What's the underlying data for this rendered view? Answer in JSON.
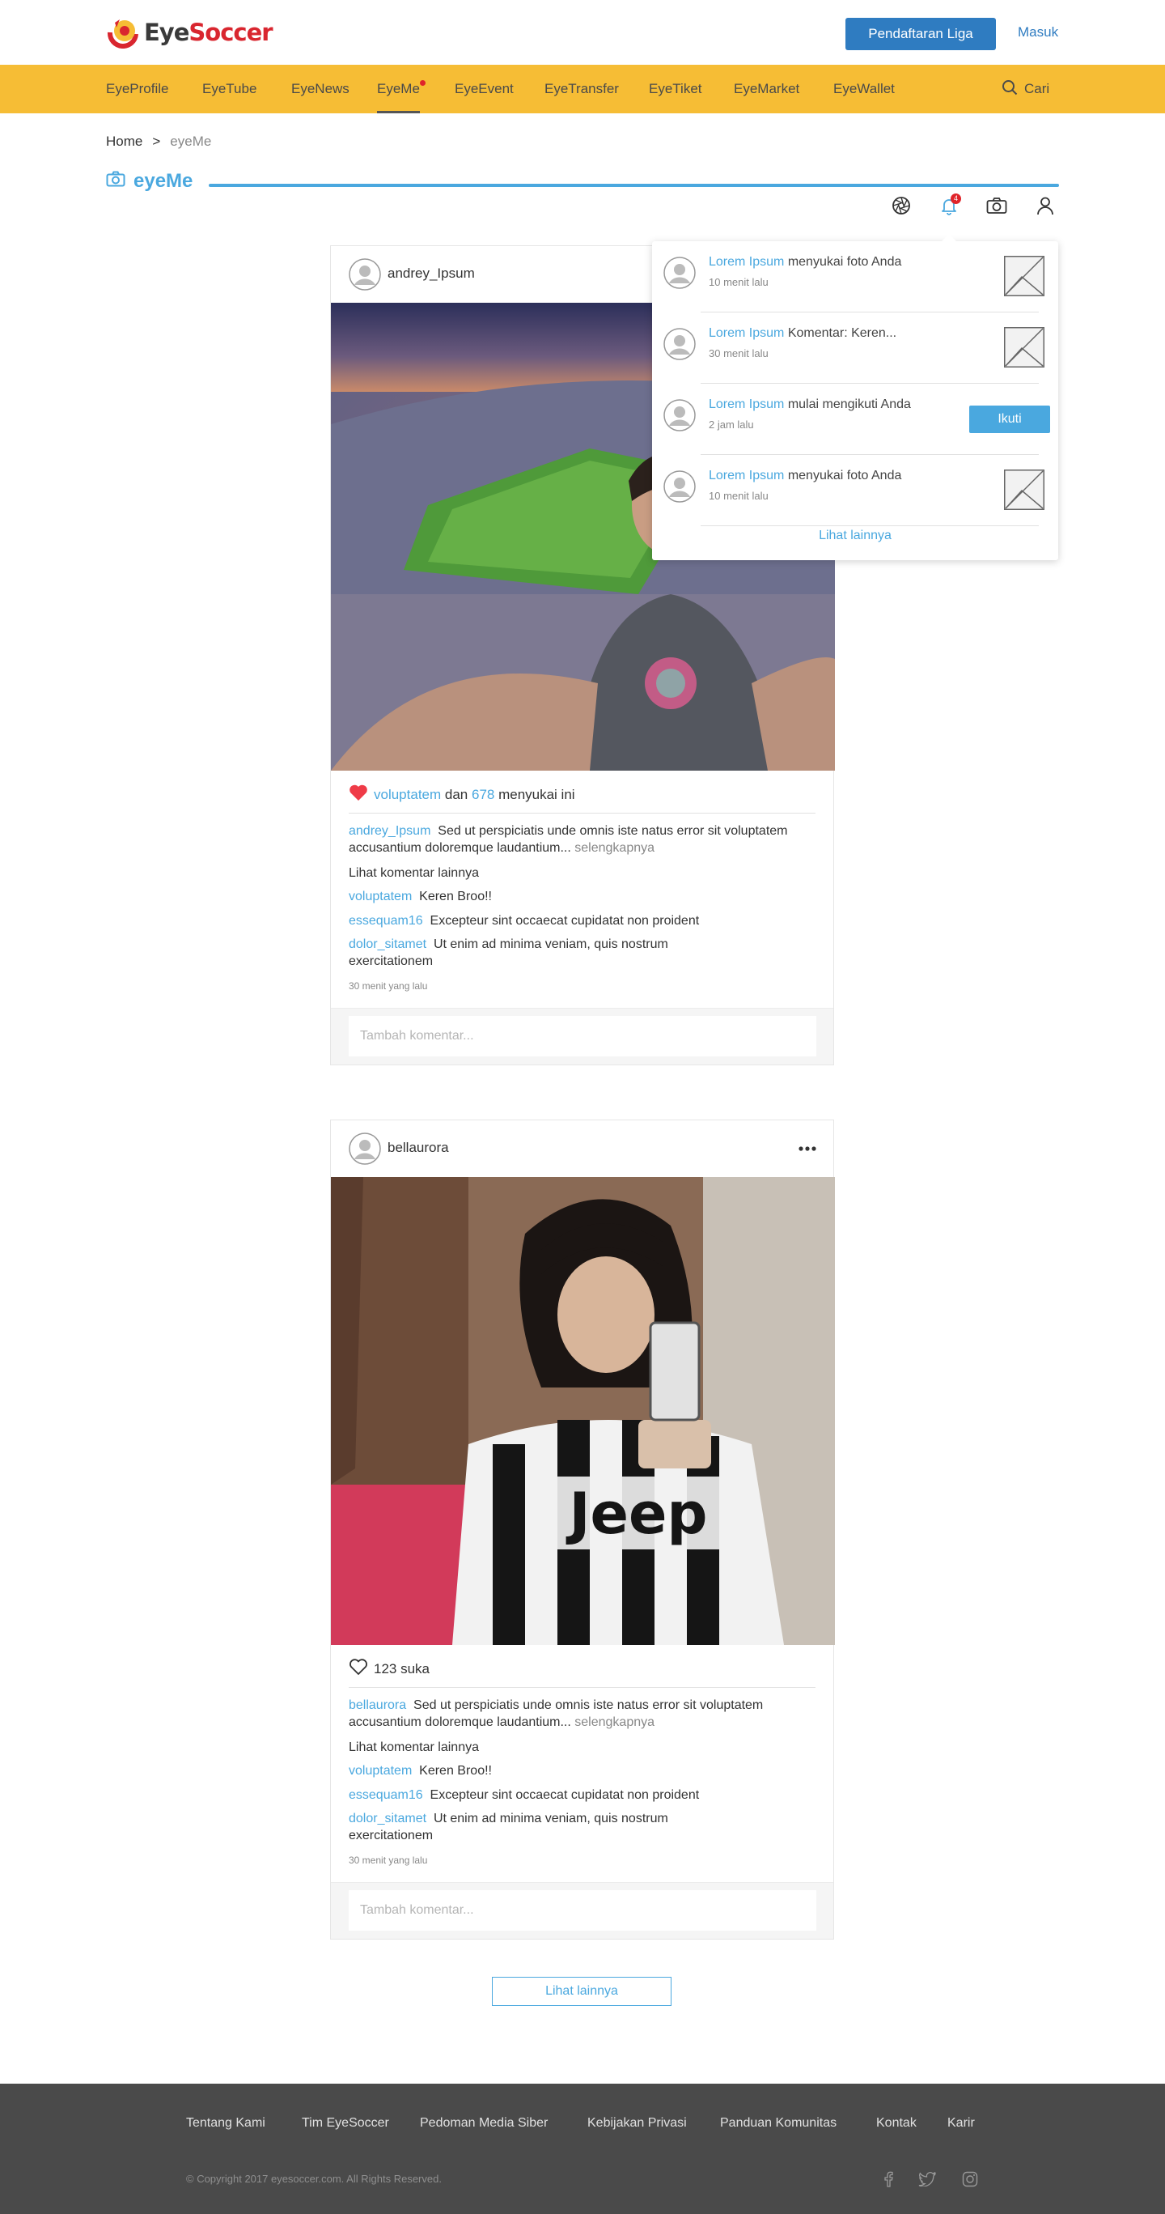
{
  "header": {
    "logo_text_a": "Eye",
    "logo_text_b": "Soccer",
    "register_label": "Pendaftaran Liga",
    "login_label": "Masuk"
  },
  "nav": {
    "items": [
      "EyeProfile",
      "EyeTube",
      "EyeNews",
      "EyeMe",
      "EyeEvent",
      "EyeTransfer",
      "EyeTiket",
      "EyeMarket",
      "EyeWallet"
    ],
    "active": "EyeMe",
    "search_label": "Cari"
  },
  "breadcrumb": {
    "home": "Home",
    "separator": ">",
    "current": "eyeMe"
  },
  "page": {
    "title": "eyeMe",
    "accent_color": "#4aa8df"
  },
  "toolbar": {
    "notification_count": "4"
  },
  "notifications": {
    "items": [
      {
        "who": "Lorem Ipsum",
        "text": " menyukai foto Anda",
        "time": "10 menit lalu",
        "action": "thumb"
      },
      {
        "who": "Lorem Ipsum",
        "text": " Komentar: Keren...",
        "time": "30 menit lalu",
        "action": "thumb"
      },
      {
        "who": "Lorem Ipsum",
        "text": " mulai mengikuti Anda",
        "time": "2 jam lalu",
        "action": "follow"
      },
      {
        "who": "Lorem Ipsum",
        "text": " menyukai foto Anda",
        "time": "10 menit lalu",
        "action": "thumb"
      }
    ],
    "follow_label": "Ikuti",
    "see_more": "Lihat lainnya"
  },
  "posts": [
    {
      "user": "andrey_Ipsum",
      "liked": true,
      "likes_user": "voluptatem",
      "likes_and": " dan ",
      "likes_count": "678",
      "likes_suffix": " menyukai ini",
      "caption_user": "andrey_Ipsum",
      "caption": "Sed ut perspiciatis unde omnis iste natus error sit voluptatem accusantium doloremque laudantium...",
      "read_more": " selengkapnya",
      "more_comments": "Lihat komentar lainnya",
      "comments": [
        {
          "user": "voluptatem",
          "text": "Keren Broo!!"
        },
        {
          "user": "essequam16",
          "text": "Excepteur sint occaecat cupidatat non proident"
        },
        {
          "user": "dolor_sitamet",
          "text": "Ut enim ad minima veniam, quis nostrum exercitationem"
        }
      ],
      "time": "30 menit yang lalu",
      "comment_placeholder": "Tambah komentar..."
    },
    {
      "user": "bellaurora",
      "liked": false,
      "likes_text": "123 suka",
      "caption_user": "bellaurora",
      "caption": "Sed ut perspiciatis unde omnis iste natus error sit voluptatem accusantium doloremque laudantium...",
      "read_more": " selengkapnya",
      "more_comments": "Lihat komentar lainnya",
      "comments": [
        {
          "user": "voluptatem",
          "text": "Keren Broo!!"
        },
        {
          "user": "essequam16",
          "text": "Excepteur sint occaecat cupidatat non proident"
        },
        {
          "user": "dolor_sitamet",
          "text": "Ut enim ad minima veniam, quis nostrum exercitationem"
        }
      ],
      "time": "30 menit yang lalu",
      "comment_placeholder": "Tambah komentar...",
      "more_icon": "more-dots-icon"
    }
  ],
  "load_more": "Lihat lainnya",
  "footer": {
    "links": [
      "Tentang Kami",
      "Tim EyeSoccer",
      "Pedoman Media Siber",
      "Kebijakan Privasi",
      "Panduan Komunitas",
      "Kontak",
      "Karir"
    ],
    "copyright": "© Copyright 2017 eyesoccer.com. All Rights Reserved.",
    "social_icons": [
      "facebook-icon",
      "twitter-icon",
      "instagram-icon"
    ]
  }
}
